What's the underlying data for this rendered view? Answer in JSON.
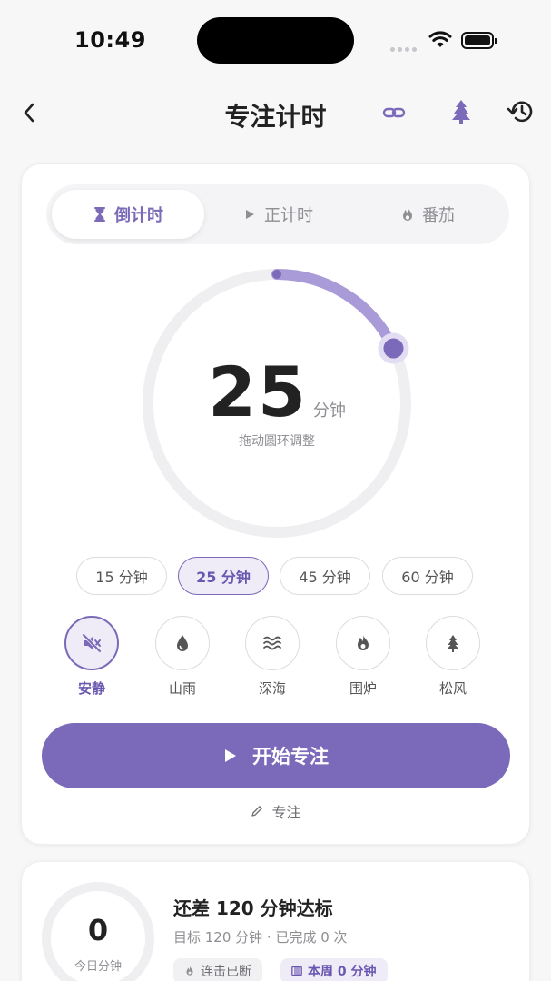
{
  "status_bar": {
    "time": "10:49"
  },
  "nav": {
    "title": "专注计时"
  },
  "mode_tabs": [
    {
      "label": "倒计时",
      "icon": "hourglass-icon",
      "active": true
    },
    {
      "label": "正计时",
      "icon": "play-icon",
      "active": false
    },
    {
      "label": "番茄",
      "icon": "flame-icon",
      "active": false
    }
  ],
  "timer": {
    "value": "25",
    "unit": "分钟",
    "hint": "拖动圆环调整",
    "progress_fraction": 0.18
  },
  "presets": [
    {
      "label": "15 分钟",
      "active": false
    },
    {
      "label": "25 分钟",
      "active": true
    },
    {
      "label": "45 分钟",
      "active": false
    },
    {
      "label": "60 分钟",
      "active": false
    }
  ],
  "sounds": [
    {
      "label": "安静",
      "icon": "mute-icon",
      "active": true
    },
    {
      "label": "山雨",
      "icon": "raindrop-icon",
      "active": false
    },
    {
      "label": "深海",
      "icon": "waves-icon",
      "active": false
    },
    {
      "label": "围炉",
      "icon": "fire-icon",
      "active": false
    },
    {
      "label": "松风",
      "icon": "pine-tree-icon",
      "active": false
    }
  ],
  "start_button": {
    "label": "开始专注"
  },
  "focus_tag": {
    "label": "专注"
  },
  "today": {
    "value": "0",
    "label": "今日分钟",
    "goal_title": "还差 120 分钟达标",
    "goal_sub": "目标 120 分钟 · 已完成 0 次",
    "chips": [
      {
        "label": "连击已断",
        "icon": "flame-icon"
      },
      {
        "label": "本周 0 分钟",
        "icon": "calendar-bars-icon"
      }
    ]
  },
  "colors": {
    "accent": "#7b6ab9",
    "accent_light": "#efecf8",
    "ring_track": "#efeff1"
  }
}
